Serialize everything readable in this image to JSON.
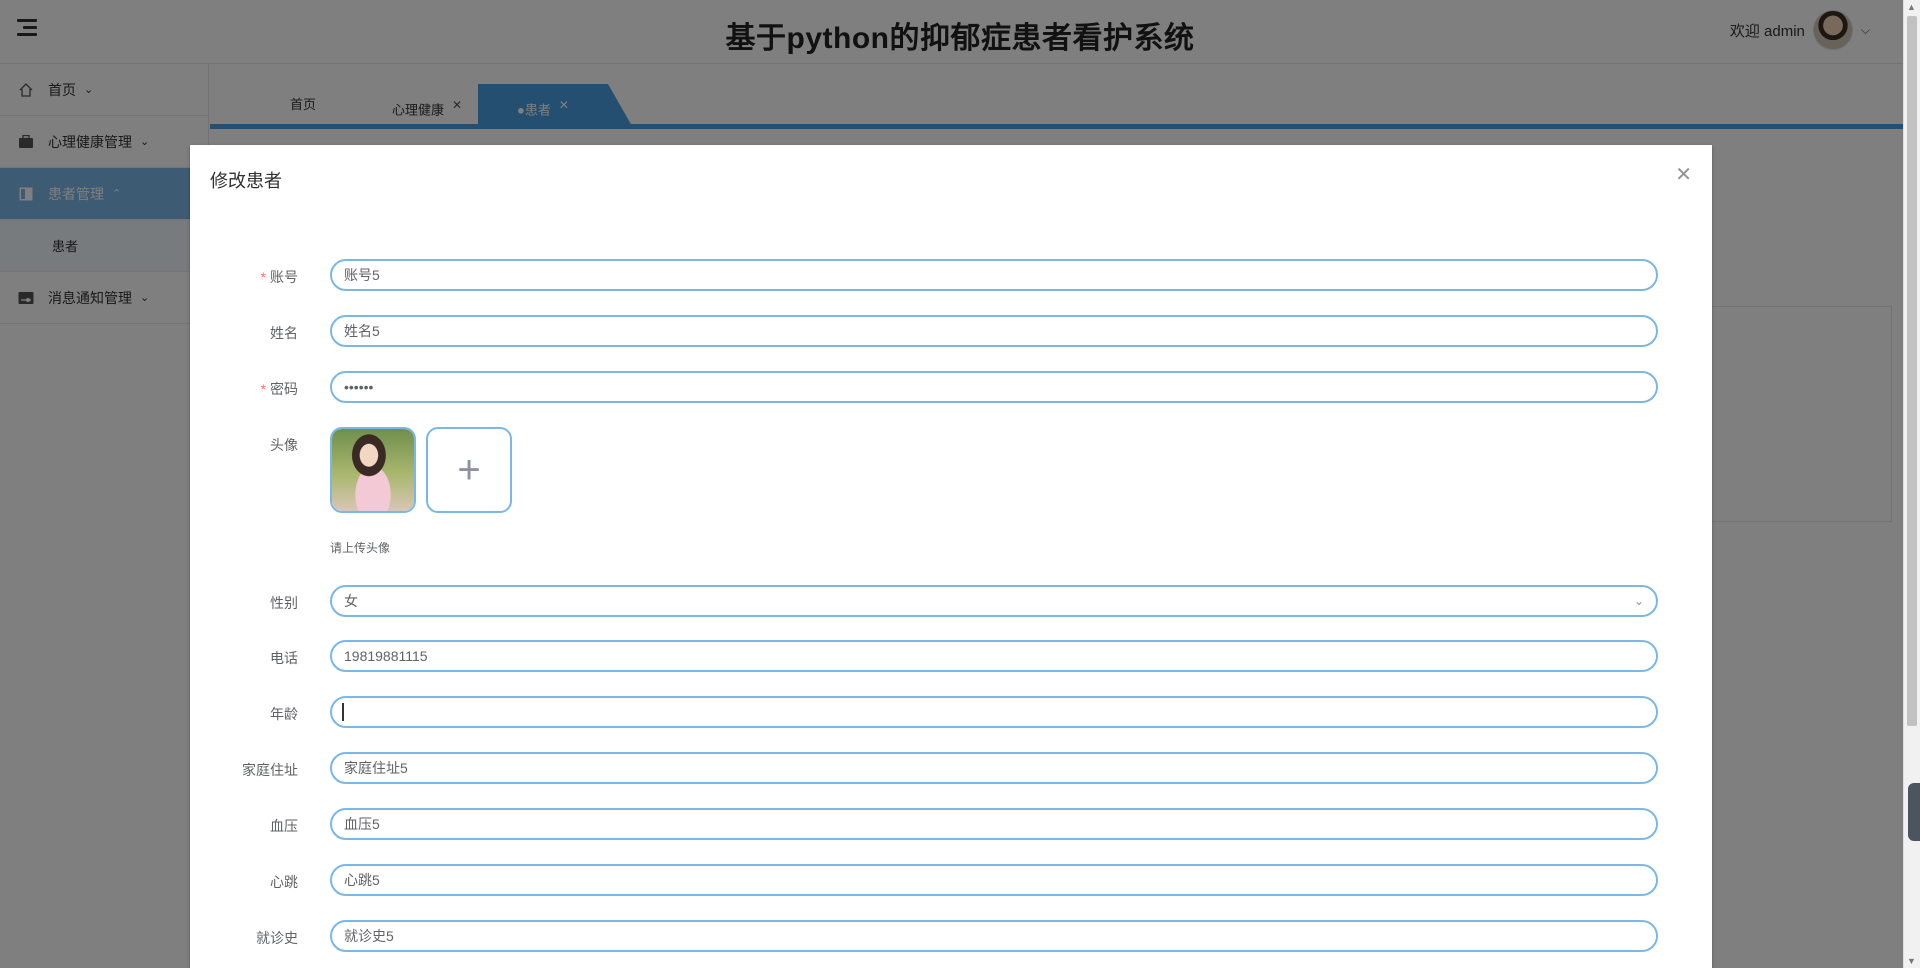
{
  "header": {
    "title": "基于python的抑郁症患者看护系统",
    "welcome": "欢迎 admin"
  },
  "sidebar": {
    "items": [
      {
        "label": "首页",
        "icon": "home-icon"
      },
      {
        "label": "心理健康管理",
        "icon": "briefcase-icon"
      },
      {
        "label": "患者管理",
        "icon": "table-icon"
      },
      {
        "label": "消息通知管理",
        "icon": "toggle-icon"
      }
    ],
    "sub_item": "患者"
  },
  "tabs": [
    {
      "label": "首页"
    },
    {
      "label": "心理健康"
    },
    {
      "label": "●患者"
    }
  ],
  "dialog": {
    "title": "修改患者",
    "fields": {
      "account": {
        "label": "账号",
        "value": "账号5",
        "required": true
      },
      "name": {
        "label": "姓名",
        "value": "姓名5"
      },
      "password": {
        "label": "密码",
        "value": "••••••",
        "required": true
      },
      "avatar": {
        "label": "头像",
        "tip": "请上传头像"
      },
      "gender": {
        "label": "性别",
        "value": "女"
      },
      "phone": {
        "label": "电话",
        "value": "19819881115"
      },
      "age": {
        "label": "年龄",
        "value": ""
      },
      "address": {
        "label": "家庭住址",
        "value": "家庭住址5"
      },
      "blood_pressure": {
        "label": "血压",
        "value": "血压5"
      },
      "heart_rate": {
        "label": "心跳",
        "value": "心跳5"
      },
      "history": {
        "label": "就诊史",
        "value": "就诊史5"
      }
    }
  },
  "colors": {
    "accent": "#4a9fe0",
    "field_border": "#7ab6e6",
    "required": "#f56c6c"
  }
}
